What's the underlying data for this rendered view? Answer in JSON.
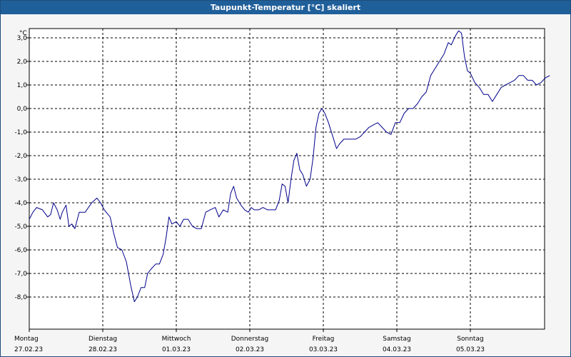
{
  "window": {
    "title": "Taupunkt-Temperatur [°C] skaliert"
  },
  "chart_data": {
    "type": "line",
    "title": "Taupunkt-Temperatur [°C] skaliert",
    "unit_label": "°C",
    "ylim": [
      -8.8,
      4.0
    ],
    "xlim": [
      0,
      7
    ],
    "y_ticks": [
      3.0,
      2.0,
      1.0,
      0.0,
      -1.0,
      -2.0,
      -3.0,
      -4.0,
      -5.0,
      -6.0,
      -7.0,
      -8.0
    ],
    "y_tick_labels": [
      "3,0",
      "2,0",
      "1,0",
      "0,0",
      "-1,0",
      "-2,0",
      "-3,0",
      "-4,0",
      "-5,0",
      "-6,0",
      "-7,0",
      "-8,0"
    ],
    "x_ticks": [
      {
        "day": "Montag",
        "date": "27.02.23"
      },
      {
        "day": "Dienstag",
        "date": "28.02.23"
      },
      {
        "day": "Mittwoch",
        "date": "01.03.23"
      },
      {
        "day": "Donnerstag",
        "date": "02.03.23"
      },
      {
        "day": "Freitag",
        "date": "03.03.23"
      },
      {
        "day": "Samstag",
        "date": "04.03.23"
      },
      {
        "day": "Sonntag",
        "date": "05.03.23"
      }
    ],
    "grid": true,
    "series": [
      {
        "color": "#00008b",
        "points": [
          [
            0.0,
            -4.7
          ],
          [
            0.05,
            -4.4
          ],
          [
            0.1,
            -4.2
          ],
          [
            0.18,
            -4.3
          ],
          [
            0.25,
            -4.6
          ],
          [
            0.29,
            -4.5
          ],
          [
            0.33,
            -4.0
          ],
          [
            0.38,
            -4.3
          ],
          [
            0.42,
            -4.7
          ],
          [
            0.45,
            -4.4
          ],
          [
            0.5,
            -4.1
          ],
          [
            0.54,
            -5.0
          ],
          [
            0.58,
            -4.9
          ],
          [
            0.62,
            -5.1
          ],
          [
            0.68,
            -4.4
          ],
          [
            0.76,
            -4.4
          ],
          [
            0.85,
            -4.0
          ],
          [
            0.92,
            -3.8
          ],
          [
            0.97,
            -4.0
          ],
          [
            1.02,
            -4.3
          ],
          [
            1.1,
            -4.6
          ],
          [
            1.15,
            -5.3
          ],
          [
            1.2,
            -5.9
          ],
          [
            1.26,
            -6.0
          ],
          [
            1.32,
            -6.5
          ],
          [
            1.38,
            -7.5
          ],
          [
            1.43,
            -8.2
          ],
          [
            1.47,
            -8.0
          ],
          [
            1.52,
            -7.6
          ],
          [
            1.57,
            -7.6
          ],
          [
            1.61,
            -7.0
          ],
          [
            1.66,
            -6.8
          ],
          [
            1.72,
            -6.6
          ],
          [
            1.77,
            -6.6
          ],
          [
            1.82,
            -6.2
          ],
          [
            1.86,
            -5.5
          ],
          [
            1.9,
            -4.6
          ],
          [
            1.94,
            -4.9
          ],
          [
            2.0,
            -4.8
          ],
          [
            2.05,
            -5.0
          ],
          [
            2.1,
            -4.7
          ],
          [
            2.16,
            -4.7
          ],
          [
            2.22,
            -5.0
          ],
          [
            2.28,
            -5.1
          ],
          [
            2.34,
            -5.1
          ],
          [
            2.4,
            -4.4
          ],
          [
            2.46,
            -4.3
          ],
          [
            2.53,
            -4.2
          ],
          [
            2.58,
            -4.6
          ],
          [
            2.64,
            -4.3
          ],
          [
            2.7,
            -4.4
          ],
          [
            2.74,
            -3.6
          ],
          [
            2.78,
            -3.3
          ],
          [
            2.82,
            -3.8
          ],
          [
            2.88,
            -4.1
          ],
          [
            2.93,
            -4.3
          ],
          [
            2.98,
            -4.4
          ],
          [
            3.02,
            -4.2
          ],
          [
            3.06,
            -4.3
          ],
          [
            3.12,
            -4.3
          ],
          [
            3.18,
            -4.2
          ],
          [
            3.24,
            -4.3
          ],
          [
            3.3,
            -4.3
          ],
          [
            3.35,
            -4.3
          ],
          [
            3.4,
            -3.9
          ],
          [
            3.44,
            -3.2
          ],
          [
            3.48,
            -3.3
          ],
          [
            3.52,
            -4.0
          ],
          [
            3.56,
            -3.0
          ],
          [
            3.6,
            -2.2
          ],
          [
            3.64,
            -1.9
          ],
          [
            3.68,
            -2.6
          ],
          [
            3.72,
            -2.8
          ],
          [
            3.77,
            -3.3
          ],
          [
            3.82,
            -3.0
          ],
          [
            3.86,
            -2.1
          ],
          [
            3.9,
            -0.8
          ],
          [
            3.94,
            -0.2
          ],
          [
            3.98,
            0.0
          ],
          [
            4.02,
            -0.2
          ],
          [
            4.07,
            -0.6
          ],
          [
            4.12,
            -1.1
          ],
          [
            4.18,
            -1.7
          ],
          [
            4.22,
            -1.5
          ],
          [
            4.28,
            -1.3
          ],
          [
            4.33,
            -1.3
          ],
          [
            4.38,
            -1.3
          ],
          [
            4.44,
            -1.3
          ],
          [
            4.5,
            -1.2
          ],
          [
            4.56,
            -1.0
          ],
          [
            4.62,
            -0.8
          ],
          [
            4.68,
            -0.7
          ],
          [
            4.74,
            -0.6
          ],
          [
            4.8,
            -0.8
          ],
          [
            4.86,
            -1.0
          ],
          [
            4.92,
            -1.1
          ],
          [
            4.98,
            -0.6
          ],
          [
            5.04,
            -0.6
          ],
          [
            5.1,
            -0.2
          ],
          [
            5.16,
            0.0
          ],
          [
            5.22,
            0.0
          ],
          [
            5.28,
            0.2
          ],
          [
            5.34,
            0.5
          ],
          [
            5.4,
            0.7
          ],
          [
            5.46,
            1.4
          ],
          [
            5.52,
            1.7
          ],
          [
            5.58,
            2.0
          ],
          [
            5.64,
            2.3
          ],
          [
            5.7,
            2.8
          ],
          [
            5.74,
            2.7
          ],
          [
            5.8,
            3.1
          ],
          [
            5.84,
            3.3
          ],
          [
            5.88,
            3.2
          ],
          [
            5.92,
            2.2
          ],
          [
            5.96,
            1.6
          ],
          [
            6.0,
            1.5
          ],
          [
            6.06,
            1.1
          ],
          [
            6.12,
            0.9
          ],
          [
            6.18,
            0.6
          ],
          [
            6.24,
            0.6
          ],
          [
            6.3,
            0.3
          ],
          [
            6.36,
            0.6
          ],
          [
            6.42,
            0.9
          ],
          [
            6.48,
            1.0
          ],
          [
            6.54,
            1.1
          ],
          [
            6.6,
            1.2
          ],
          [
            6.66,
            1.4
          ],
          [
            6.72,
            1.4
          ],
          [
            6.78,
            1.2
          ],
          [
            6.84,
            1.2
          ],
          [
            6.9,
            1.0
          ],
          [
            6.96,
            1.1
          ],
          [
            7.02,
            1.3
          ],
          [
            7.08,
            1.4
          ]
        ]
      }
    ]
  }
}
